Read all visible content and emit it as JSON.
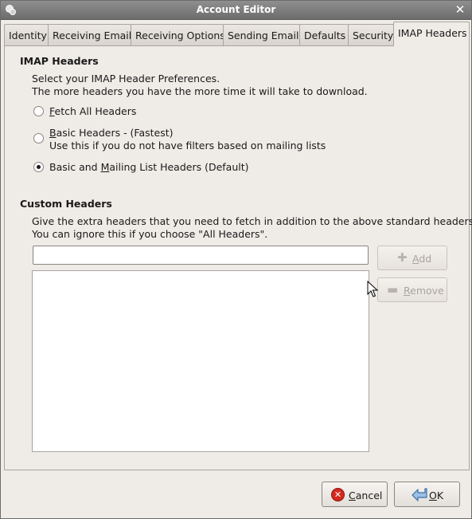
{
  "window": {
    "title": "Account Editor"
  },
  "tabs": [
    "Identity",
    "Receiving Email",
    "Receiving Options",
    "Sending Email",
    "Defaults",
    "Security",
    "IMAP Headers"
  ],
  "imap": {
    "heading": "IMAP Headers",
    "desc1": "Select your IMAP Header Preferences.",
    "desc2": "The more headers you have the more time it will take to download.",
    "opt_all_mn": "F",
    "opt_all_rest": "etch All Headers",
    "opt_basic_mn": "B",
    "opt_basic_rest": "asic Headers - (Fastest)",
    "opt_basic_sub": "Use this if you do not have filters based on mailing lists",
    "opt_mailing_pre": "Basic and ",
    "opt_mailing_mn": "M",
    "opt_mailing_rest": "ailing List Headers (Default)",
    "selected": "Basic and Mailing List Headers (Default)"
  },
  "custom": {
    "heading": "Custom Headers",
    "desc1": "Give the extra headers that you need to fetch in addition to the above standard headers.",
    "desc2": "You can ignore this if you choose \"All Headers\".",
    "entry_value": "",
    "add_mn": "A",
    "add_rest": "dd",
    "remove_mn": "R",
    "remove_rest": "emove"
  },
  "buttons": {
    "cancel_mn": "C",
    "cancel_rest": "ancel",
    "ok_mn": "O",
    "ok_rest": "K"
  },
  "icons": {
    "app": "account-editor-icon",
    "close": "close-icon",
    "add": "plus-icon",
    "remove": "minus-icon",
    "cancel": "cancel-icon",
    "ok": "ok-arrow-icon"
  }
}
